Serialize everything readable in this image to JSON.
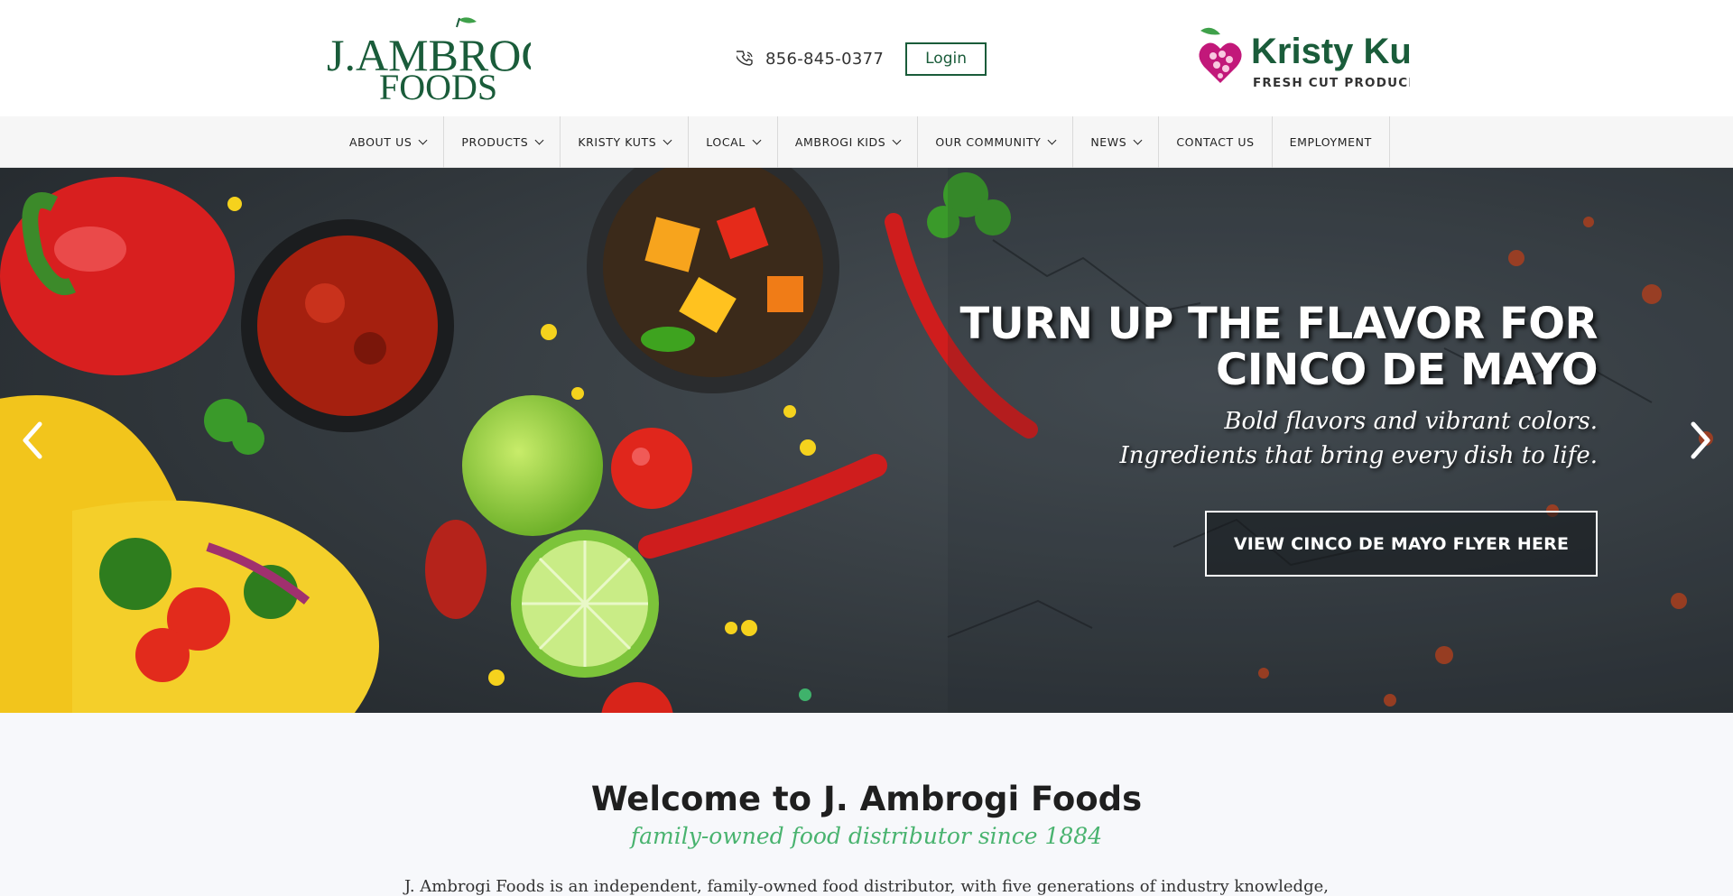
{
  "header": {
    "logo_main": {
      "line1": "J.AMBROGI",
      "line2": "FOODS"
    },
    "phone": "856-845-0377",
    "login_label": "Login",
    "logo_partner": {
      "name": "Kristy Kuts",
      "tagline": "FRESH CUT PRODUCE"
    }
  },
  "nav": {
    "items": [
      {
        "label": "ABOUT US",
        "has_dropdown": true
      },
      {
        "label": "PRODUCTS",
        "has_dropdown": true
      },
      {
        "label": "KRISTY KUTS",
        "has_dropdown": true
      },
      {
        "label": "LOCAL",
        "has_dropdown": true
      },
      {
        "label": "AMBROGI KIDS",
        "has_dropdown": true
      },
      {
        "label": "OUR COMMUNITY",
        "has_dropdown": true
      },
      {
        "label": "NEWS",
        "has_dropdown": true
      },
      {
        "label": "CONTACT US",
        "has_dropdown": false
      },
      {
        "label": "EMPLOYMENT",
        "has_dropdown": false
      }
    ]
  },
  "hero": {
    "title_line1": "TURN UP THE FLAVOR FOR",
    "title_line2": "CINCO DE MAYO",
    "subtitle_line1": "Bold flavors and vibrant colors.",
    "subtitle_line2": "Ingredients that bring every dish to life.",
    "cta_label": "VIEW CINCO DE MAYO FLYER HERE",
    "slide_count": 1,
    "active_slide": 1
  },
  "welcome": {
    "title": "Welcome to J. Ambrogi Foods",
    "tagline": "family-owned food distributor since 1884",
    "body": "J. Ambrogi Foods is an independent, family-owned food distributor, with five generations of industry knowledge,"
  },
  "colors": {
    "brand_green": "#1a5c3a",
    "accent_green": "#49b36f",
    "brand_magenta": "#c2187a",
    "partner_green": "#7cb342"
  },
  "icons": {
    "phone": "phone-icon",
    "chevron": "chevron-down-icon",
    "prev": "chevron-left-icon",
    "next": "chevron-right-icon"
  }
}
